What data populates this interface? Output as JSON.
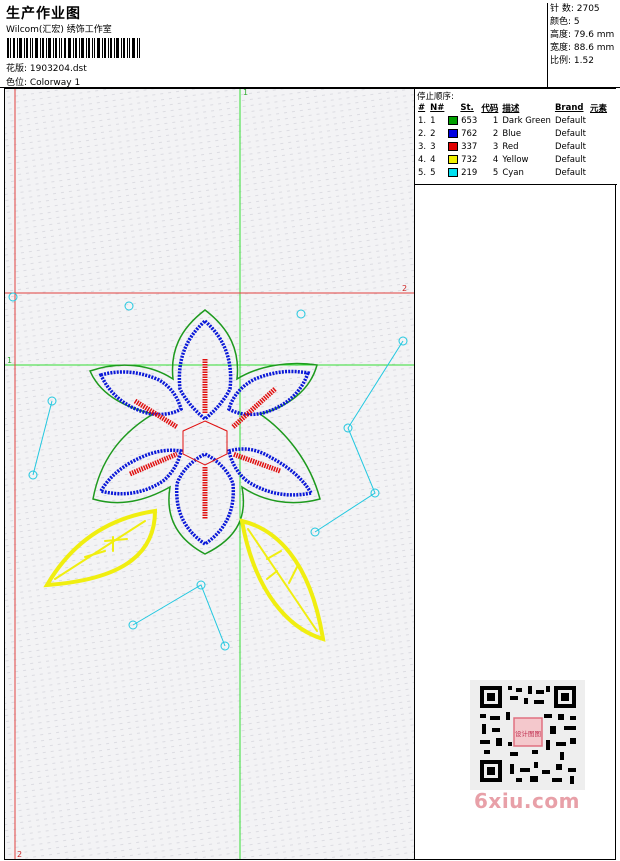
{
  "header": {
    "title": "生产作业图",
    "subtitle": "Wilcom(汇宏) 绣饰工作室",
    "design_label": "花版: 1903204.dst",
    "colorway_label": "色位: Colorway 1"
  },
  "stats": {
    "stitches": "针 数: 2705",
    "colors": "颜色: 5",
    "height": "高度: 79.6 mm",
    "width": "宽度: 88.6 mm",
    "scale": "比例: 1.52"
  },
  "color_panel": {
    "title": "停止顺序:",
    "headers": [
      "#",
      "N#",
      "St.",
      "代码",
      "描述",
      "Brand",
      "元素"
    ],
    "rows": [
      {
        "idx": "1.",
        "n": "1",
        "hex": "#00a000",
        "st": "653",
        "code": "1",
        "desc": "Dark Green",
        "brand": "Default"
      },
      {
        "idx": "2.",
        "n": "2",
        "hex": "#0000e0",
        "st": "762",
        "code": "2",
        "desc": "Blue",
        "brand": "Default"
      },
      {
        "idx": "3.",
        "n": "3",
        "hex": "#e00000",
        "st": "337",
        "code": "3",
        "desc": "Red",
        "brand": "Default"
      },
      {
        "idx": "4.",
        "n": "4",
        "hex": "#f0f000",
        "st": "732",
        "code": "4",
        "desc": "Yellow",
        "brand": "Default"
      },
      {
        "idx": "5.",
        "n": "5",
        "hex": "#00e0f0",
        "st": "219",
        "code": "5",
        "desc": "Cyan",
        "brand": "Default"
      }
    ]
  },
  "guides": {
    "green_v_label": "1",
    "green_h_label": "1",
    "red_h_label": "2",
    "red_v_label": "2"
  },
  "watermark": {
    "site": "6xiu.com",
    "stamp": "设计图图"
  }
}
